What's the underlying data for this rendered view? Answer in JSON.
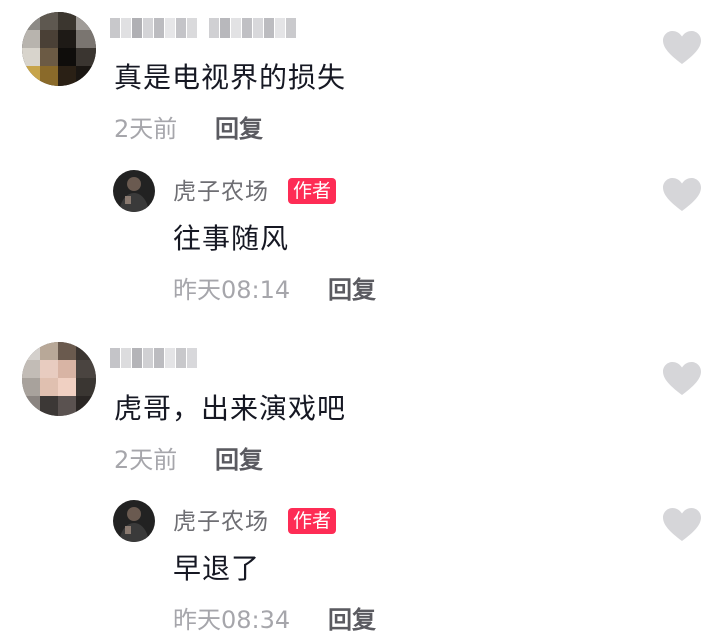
{
  "comments": [
    {
      "text": "真是电视界的损失",
      "time": "2天前",
      "reply_label": "回复",
      "reply": {
        "author": "虎子农场",
        "badge": "作者",
        "text": "往事随风",
        "time": "昨天08:14",
        "reply_label": "回复"
      }
    },
    {
      "text": "虎哥，出来演戏吧",
      "time": "2天前",
      "reply_label": "回复",
      "reply": {
        "author": "虎子农场",
        "badge": "作者",
        "text": "早退了",
        "time": "昨天08:34",
        "reply_label": "回复"
      }
    }
  ],
  "colors": {
    "badge_bg": "#fe2c55",
    "like_icon": "#d6d6d9",
    "time_text": "#a6a6ab"
  },
  "icons": {
    "like": "heart-icon"
  }
}
